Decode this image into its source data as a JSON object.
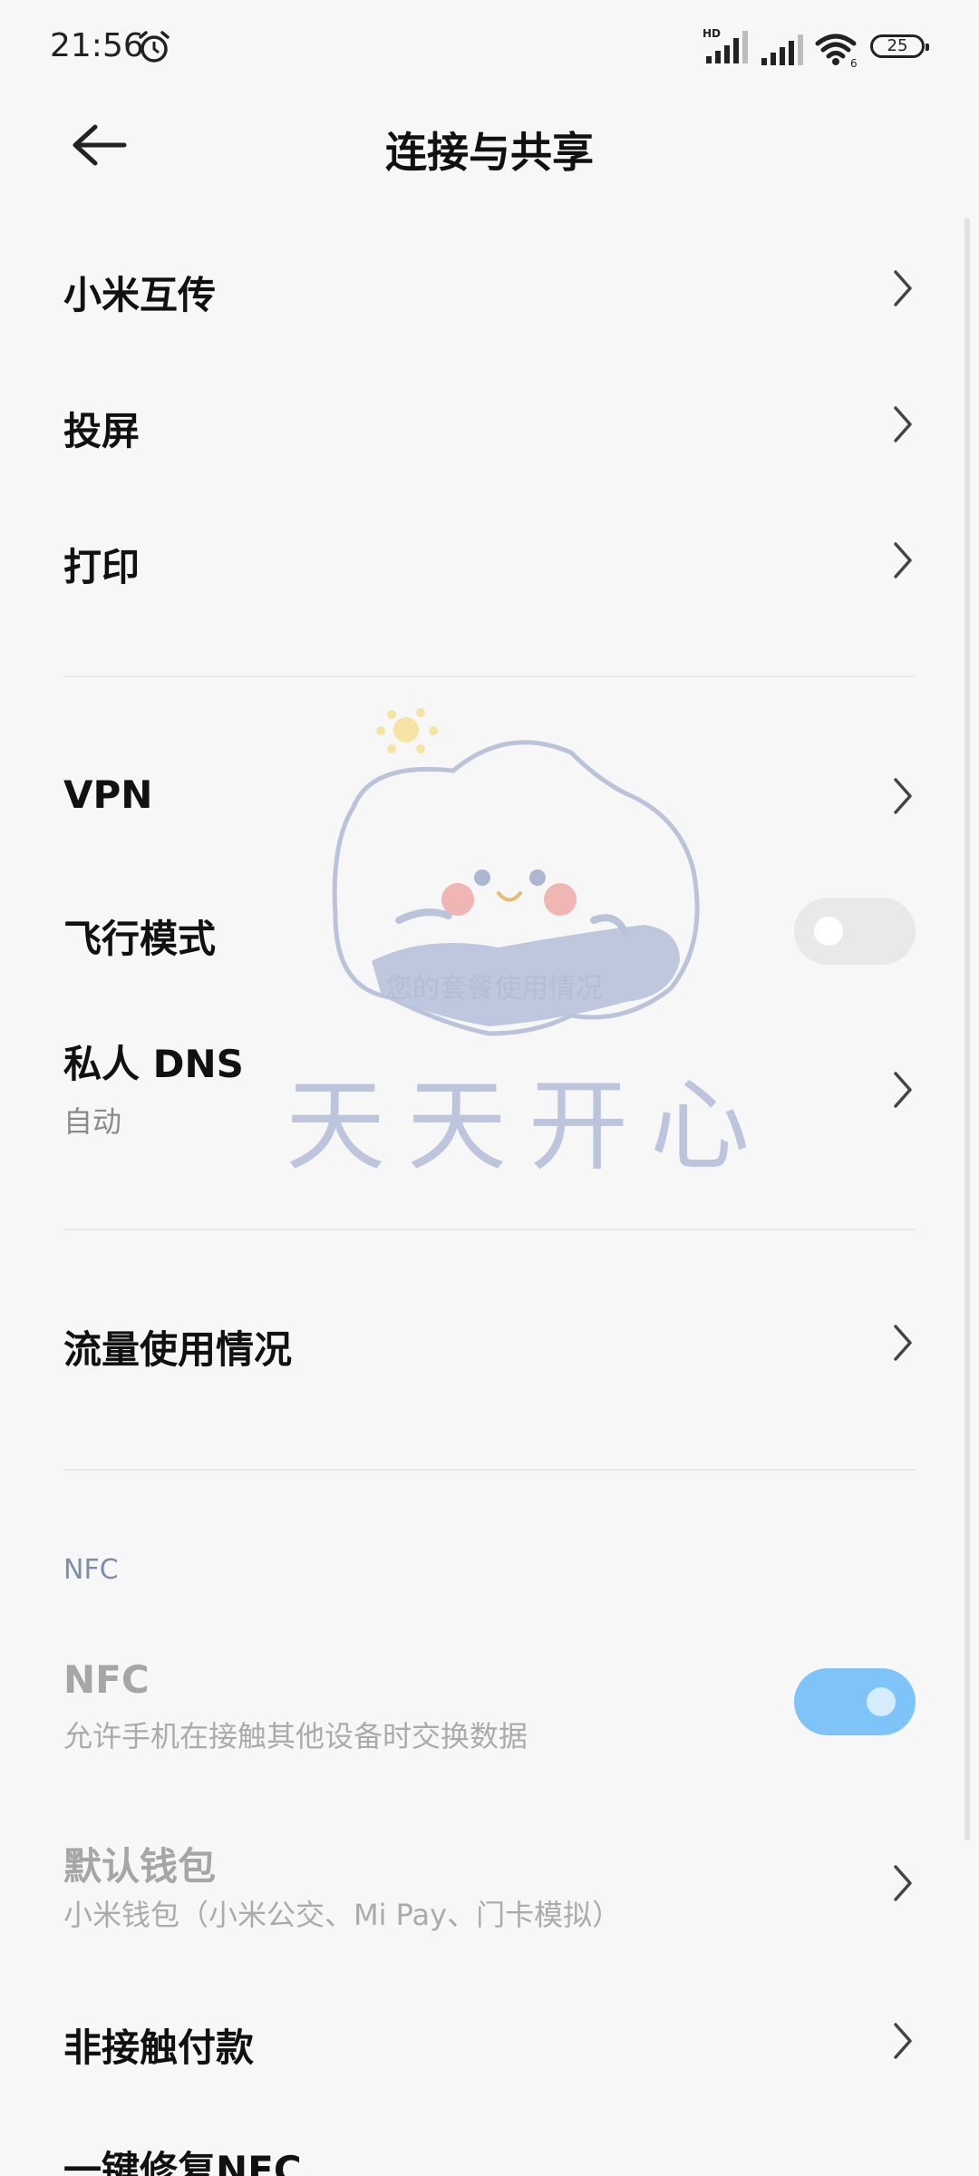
{
  "status_bar": {
    "time": "21:56",
    "hd_label": "HD",
    "wifi_badge": "6",
    "battery": "25"
  },
  "header": {
    "title": "连接与共享"
  },
  "rows": {
    "mi_share": {
      "title": "小米互传"
    },
    "cast": {
      "title": "投屏"
    },
    "print": {
      "title": "打印"
    },
    "vpn": {
      "title": "VPN"
    },
    "airplane": {
      "title": "飞行模式",
      "toggle_state": "off"
    },
    "private_dns": {
      "title": "私人 DNS",
      "subtitle": "自动"
    },
    "data_usage": {
      "title": "流量使用情况"
    },
    "nfc_section": "NFC",
    "nfc": {
      "title": "NFC",
      "subtitle": "允许手机在接触其他设备时交换数据",
      "toggle_state": "on"
    },
    "default_wallet": {
      "title": "默认钱包",
      "subtitle": "小米钱包（小米公交、Mi Pay、门卡模拟）"
    },
    "contactless_pay": {
      "title": "非接触付款"
    },
    "repair_nfc": {
      "title": "一键修复NFC"
    }
  },
  "overlay_sticker": {
    "text": "天天开心",
    "hidden_text": "您的套餐使用情况"
  },
  "colors": {
    "background": "#f7f7f7",
    "toggle_on": "#7ec4f8",
    "section_label": "#7d8fa8"
  }
}
